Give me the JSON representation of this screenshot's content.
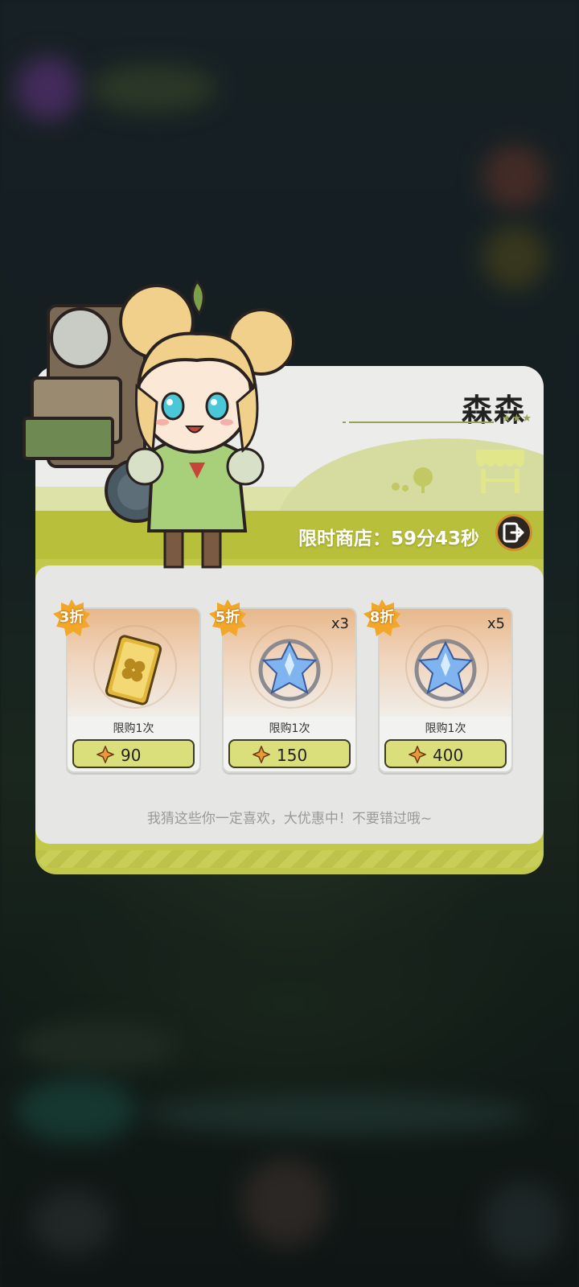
{
  "npc": {
    "name": "森森",
    "stars": "★★★"
  },
  "shop": {
    "timer_label": "限时商店：59分43秒",
    "exit_icon": "exit-icon",
    "slogan": "我猜这些你一定喜欢，大优惠中！不要错过哦~"
  },
  "items": [
    {
      "discount": "3折",
      "quantity": "",
      "limit": "限购1次",
      "price": "90",
      "icon": "clover-card-icon"
    },
    {
      "discount": "5折",
      "quantity": "x3",
      "limit": "限购1次",
      "price": "150",
      "icon": "blue-crystal-icon"
    },
    {
      "discount": "8折",
      "quantity": "x5",
      "limit": "限购1次",
      "price": "400",
      "icon": "blue-crystal-icon"
    }
  ],
  "colors": {
    "accent_green": "#b8bf3a",
    "badge_orange": "#f2a72a",
    "panel_bg": "#e6e6e4"
  }
}
